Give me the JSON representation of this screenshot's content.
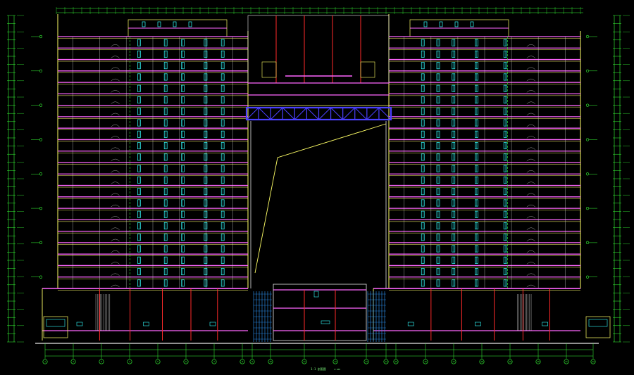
{
  "drawing": {
    "title": "1-1 剖面图",
    "scale_note": "1:100",
    "colors": {
      "background": "#000000",
      "dim": "#37ff37",
      "wall": "#ffff66",
      "floor": "#ff66ff",
      "column": "#ff2a2a",
      "window": "#33ffff",
      "truss": "#4b40ff",
      "white": "#e8e8e8",
      "glass": "#2f9bff"
    },
    "axes": [
      "1",
      "2",
      "3",
      "4",
      "5",
      "6",
      "7",
      "8",
      "9",
      "10",
      "11",
      "12",
      "13",
      "14",
      "15",
      "16",
      "17",
      "18",
      "19",
      "20",
      "21",
      "22"
    ],
    "left_tower_floors": 22,
    "right_tower_floors": 22
  }
}
